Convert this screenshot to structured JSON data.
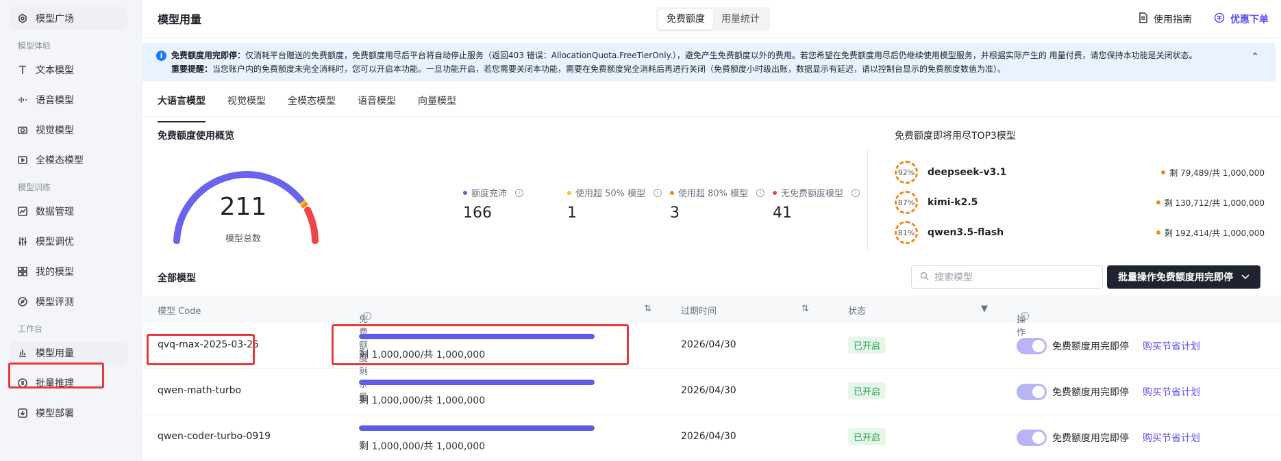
{
  "sidebar": {
    "items": [
      {
        "label": "模型广场",
        "icon": "plaza-icon",
        "active": false
      },
      {
        "group": "模型体验"
      },
      {
        "label": "文本模型",
        "icon": "text-icon"
      },
      {
        "label": "语音模型",
        "icon": "voice-icon"
      },
      {
        "label": "视觉模型",
        "icon": "camera-icon"
      },
      {
        "label": "全模态模型",
        "icon": "multimodal-icon"
      },
      {
        "group": "模型训练"
      },
      {
        "label": "数据管理",
        "icon": "chart-line-icon"
      },
      {
        "label": "模型调优",
        "icon": "sliders-icon"
      },
      {
        "label": "我的模型",
        "icon": "grid-icon"
      },
      {
        "label": "模型评测",
        "icon": "compass-icon"
      },
      {
        "group": "工作台"
      },
      {
        "label": "模型用量",
        "icon": "bar-chart-icon",
        "active": true
      },
      {
        "label": "批量推理",
        "icon": "list-icon"
      },
      {
        "label": "模型部署",
        "icon": "deploy-icon"
      }
    ]
  },
  "header": {
    "title": "模型用量",
    "seg_free": "免费额度",
    "seg_stats": "用量统计",
    "guide": "使用指南",
    "promo": "优惠下单"
  },
  "notice": {
    "line1_bold": "免费额度用完即停：",
    "line1": "仅消耗平台赠送的免费额度，免费额度用尽后平台将自动停止服务（返回403 错误：AllocationQuota.FreeTierOnly.），避免产生免费额度以外的费用。若您希望在免费额度用尽后仍继续使用模型服务，并根据实际产生的 用量付费，请您保持本功能是关闭状态。",
    "line2_bold": "重要提醒：",
    "line2": "当您账户内的免费额度未完全消耗时，您可以开启本功能。一旦功能开启，若您需要关闭本功能，需要在免费额度完全消耗后再进行关闭（免费额度小时级出账，数据显示有延迟，请以控制台显示的免费额度数值为准）。"
  },
  "tabs": [
    "大语言模型",
    "视觉模型",
    "全模态模型",
    "语音模型",
    "向量模型"
  ],
  "overview": {
    "title": "免费额度使用概览",
    "total": "211",
    "total_label": "模型总数",
    "stats": [
      {
        "label": "额度充沛",
        "value": "166",
        "color": "#5e5ce6"
      },
      {
        "label": "使用超 50% 模型",
        "value": "1",
        "color": "#f5c518"
      },
      {
        "label": "使用超 80% 模型",
        "value": "3",
        "color": "#f08a1a"
      },
      {
        "label": "无免费额度模型",
        "value": "41",
        "color": "#f04545"
      }
    ]
  },
  "top3": {
    "title": "免费额度即将用尽TOP3模型",
    "items": [
      {
        "pct": "92%",
        "name": "deepseek-v3.1",
        "remain": "剩 79,489/共 1,000,000"
      },
      {
        "pct": "87%",
        "name": "kimi-k2.5",
        "remain": "剩 130,712/共 1,000,000"
      },
      {
        "pct": "81%",
        "name": "qwen3.5-flash",
        "remain": "剩 192,414/共 1,000,000"
      }
    ]
  },
  "all_models": {
    "title": "全部模型",
    "search_placeholder": "搜索模型",
    "batch_button": "批量操作免费额度用完即停",
    "columns": {
      "code": "模型 Code",
      "remain": "免费额度剩余量",
      "expire": "过期时间",
      "status": "状态",
      "action": "操作"
    },
    "rows": [
      {
        "code": "qvq-max-2025-03-25",
        "remain_fraction": 1.0,
        "remain_text": "剩 1,000,000/共 1,000,000",
        "expire": "2026/04/30",
        "status": "已开启",
        "toggle_label": "免费额度用完即停",
        "buy": "购买节省计划"
      },
      {
        "code": "qwen-math-turbo",
        "remain_fraction": 1.0,
        "remain_text": "剩 1,000,000/共 1,000,000",
        "expire": "2026/04/30",
        "status": "已开启",
        "toggle_label": "免费额度用完即停",
        "buy": "购买节省计划"
      },
      {
        "code": "qwen-coder-turbo-0919",
        "remain_fraction": 1.0,
        "remain_text": "剩 1,000,000/共 1,000,000",
        "expire": "2026/04/30",
        "status": "已开启",
        "toggle_label": "免费额度用完即停",
        "buy": "购买节省计划"
      }
    ]
  },
  "colors": {
    "accent": "#5b4ff0",
    "bar": "#5e5ce6",
    "highlight": "#e5393b",
    "status_on": "#1e9e4a"
  }
}
